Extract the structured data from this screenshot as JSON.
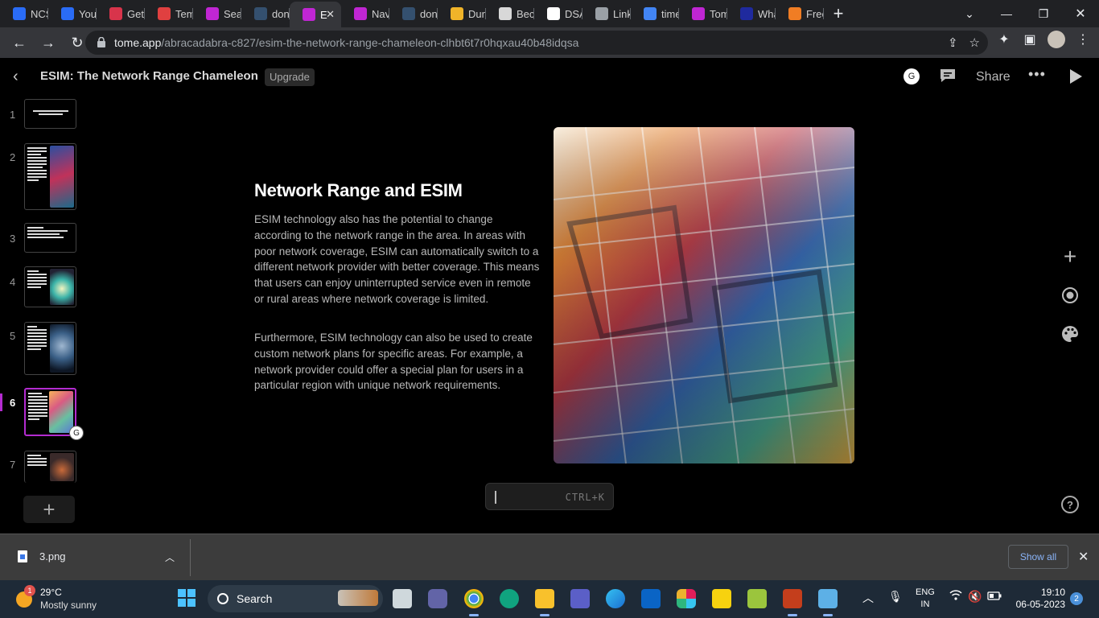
{
  "browser": {
    "tabs": [
      {
        "label": "NCS",
        "icon": "ncs-icon",
        "color": "#2a6cf6"
      },
      {
        "label": "Your",
        "icon": "si-icon",
        "color": "#2a6cf6"
      },
      {
        "label": "Get",
        "icon": "get-icon",
        "color": "#d8344b"
      },
      {
        "label": "Tem",
        "icon": "mail-icon",
        "color": "#e04040"
      },
      {
        "label": "Sear",
        "icon": "tome-icon",
        "color": "#c026d3"
      },
      {
        "label": "don",
        "icon": "pt-icon",
        "color": "#34506f"
      },
      {
        "label": "E",
        "icon": "tome-icon",
        "color": "#c026d3"
      },
      {
        "label": "Navi",
        "icon": "tome-icon",
        "color": "#c026d3"
      },
      {
        "label": "don",
        "icon": "pt-icon",
        "color": "#34506f"
      },
      {
        "label": "Dun",
        "icon": "crown-icon",
        "color": "#f0b429"
      },
      {
        "label": "Becc",
        "icon": "becc-icon",
        "color": "#d8d8d8"
      },
      {
        "label": "DSA",
        "icon": "github-icon",
        "color": "#ffffff"
      },
      {
        "label": "Link",
        "icon": "globe-icon",
        "color": "#9aa0a6"
      },
      {
        "label": "time",
        "icon": "google-icon",
        "color": "#4285f4"
      },
      {
        "label": "Tom",
        "icon": "tome-icon",
        "color": "#c026d3"
      },
      {
        "label": "Wha",
        "icon": "wha-icon",
        "color": "#1f2a9e"
      },
      {
        "label": "Free",
        "icon": "free-icon",
        "color": "#f07d24"
      }
    ],
    "active_tab_index": 6,
    "url_domain": "tome.app",
    "url_path": "/abracadabra-c827/esim-the-network-range-chameleon-clhbt6t7r0hqxau40b48idqsa"
  },
  "app": {
    "title": "ESIM: The Network Range Chameleon",
    "upgrade_label": "Upgrade",
    "avatar_letter": "G",
    "share_label": "Share"
  },
  "thumbnails": {
    "numbers": [
      "1",
      "2",
      "3",
      "4",
      "5",
      "6",
      "7"
    ],
    "active": "6",
    "collab_letter": "G"
  },
  "slide": {
    "title": "Network Range and ESIM",
    "paragraph1": "ESIM technology also has the potential to change according to the network range in the area. In areas with poor network coverage, ESIM can automatically switch to a different network provider with better coverage. This means that users can enjoy uninterrupted service even in remote or rural areas where network coverage is limited.",
    "paragraph2": "Furthermore, ESIM technology can also be used to create custom network plans for specific areas. For example, a network provider could offer a special plan for users in a particular region with unique network requirements.",
    "command_hint": "CTRL+K"
  },
  "downloads": {
    "file_name": "3.png",
    "show_all_label": "Show all"
  },
  "taskbar": {
    "weather_temp": "29°C",
    "weather_condition": "Mostly sunny",
    "weather_badge": "1",
    "search_label": "Search",
    "lang_top": "ENG",
    "lang_bottom": "IN",
    "time": "19:10",
    "date": "06-05-2023",
    "notification_count": "2"
  },
  "colors": {
    "accent": "#b32bd0",
    "link": "#8ab4f8"
  }
}
